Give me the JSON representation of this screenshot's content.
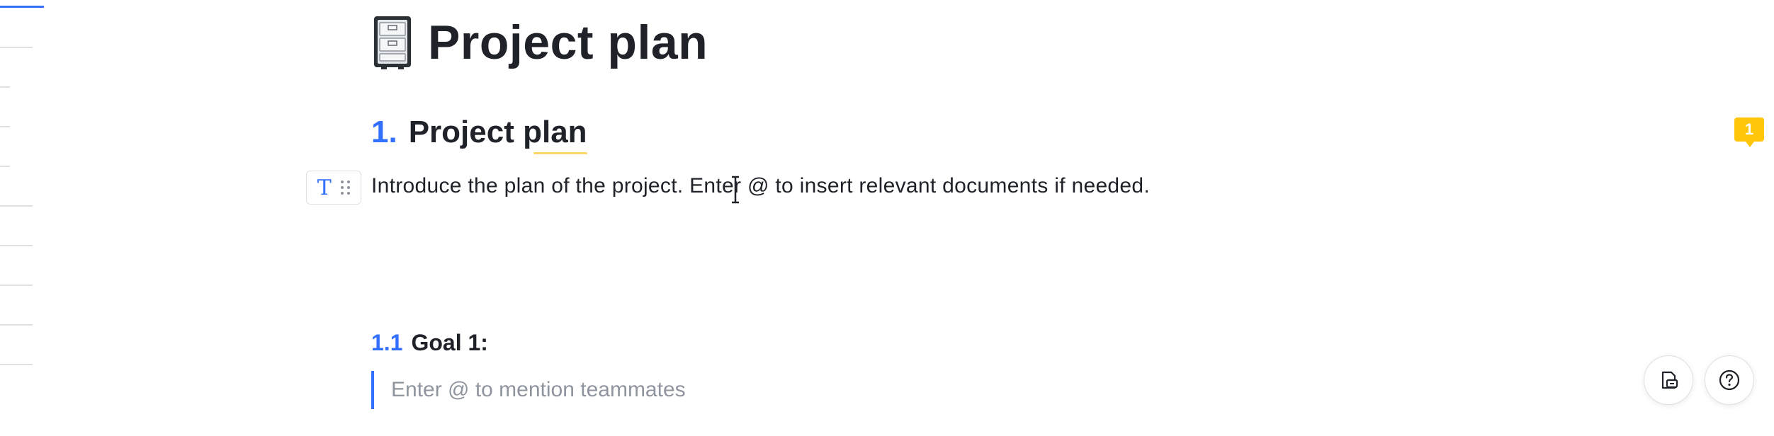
{
  "document": {
    "title": "Project plan",
    "title_icon": "file-cabinet-icon",
    "heading1": {
      "number": "1.",
      "text": "Project plan"
    },
    "paragraph": "Introduce the plan of the project. Enter @ to insert relevant documents if needed.",
    "heading2": {
      "number": "1.1",
      "text": "Goal 1:"
    },
    "quote_placeholder": "Enter @ to mention teammates"
  },
  "block_toolbar": {
    "type_icon_glyph": "T",
    "type_icon": "text-type-icon",
    "drag_icon": "drag-handle-icon"
  },
  "comments": {
    "count": "1"
  },
  "floating_actions": [
    {
      "icon": "document-comment-icon"
    },
    {
      "icon": "help-icon"
    }
  ],
  "colors": {
    "accent": "#3370ff",
    "text": "#1f2329",
    "placeholder": "#8f959e",
    "comment_badge": "#ffc60a",
    "highlight_underline": "#ffd666"
  }
}
